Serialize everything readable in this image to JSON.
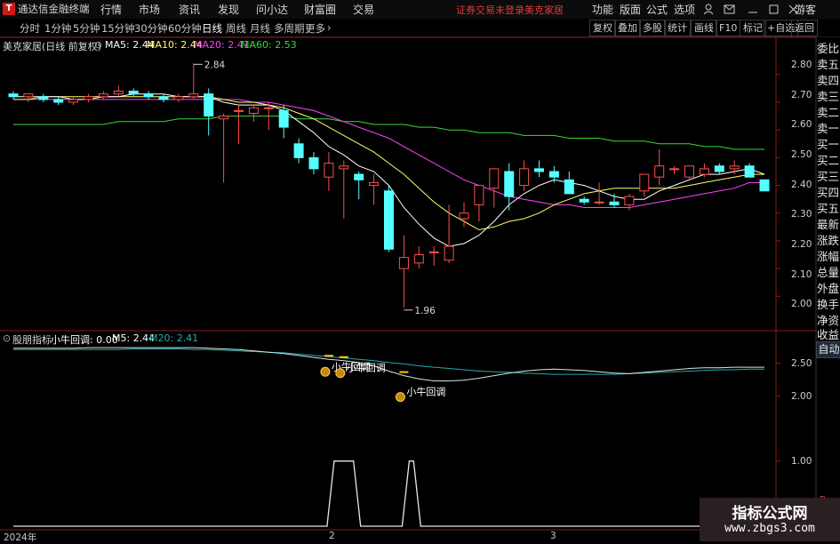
{
  "menubar": {
    "app_title": "通达信金融终端",
    "items": [
      "行情",
      "市场",
      "资讯",
      "发现",
      "问小达",
      "财富圈",
      "交易"
    ],
    "status_login": "证券交易未登录",
    "status_stock": "美克家居",
    "right_items": [
      "功能",
      "版面",
      "公式",
      "选项"
    ],
    "guest": "游客"
  },
  "toolbar": {
    "periods": [
      "分时",
      "1分钟",
      "5分钟",
      "15分钟",
      "30分钟",
      "60分钟",
      "日线",
      "周线",
      "月线",
      "多周期",
      "更多"
    ],
    "active_period": "日线",
    "right_buttons": [
      "复权",
      "叠加",
      "多股",
      "统计",
      "画线",
      "F10",
      "标记",
      "+自选",
      "返回"
    ]
  },
  "main_legend": {
    "title": "美克家居(日线 前复权)",
    "ma5": "MA5: 2.44",
    "ma10": "MA10: 2.44",
    "ma20": "MA20: 2.41",
    "ma60": "MA60: 2.53",
    "high_label": "2.84",
    "low_label": "1.96"
  },
  "sub_legend": {
    "name": "股朋指标",
    "signal": "小牛回调: 0.00",
    "m5": "M5: 2.44",
    "m20": "M20: 2.41",
    "marker_label": "小牛回调"
  },
  "main_axis": [
    "2.80",
    "2.70",
    "2.60",
    "2.50",
    "2.40",
    "2.30",
    "2.20",
    "2.10",
    "2.00"
  ],
  "sub_axis": [
    "2.50",
    "2.00",
    "1.00"
  ],
  "r_label": "R",
  "x_axis": [
    "2024年",
    "2",
    "3"
  ],
  "side_panel": [
    "委比",
    "卖五",
    "卖四",
    "卖三",
    "卖二",
    "卖一",
    "买一",
    "买二",
    "买三",
    "买四",
    "买五",
    "最新",
    "涨跌",
    "涨幅",
    "总量",
    "外盘",
    "换手",
    "净资",
    "收益"
  ],
  "side_auto": "自动",
  "watermark": {
    "title": "指标公式网",
    "url": "www.zbgs3.com"
  },
  "colors": {
    "up": "#ff4d4d",
    "down": "#54ffff",
    "ma5": "#ffffff",
    "ma10": "#ffff66",
    "ma20": "#ff44ff",
    "ma60": "#33dd33",
    "m20": "#22aaaa"
  },
  "chart_data": {
    "type": "candlestick",
    "ylim": [
      1.94,
      2.87
    ],
    "candles": [
      {
        "o": 2.73,
        "h": 2.74,
        "l": 2.71,
        "c": 2.72
      },
      {
        "o": 2.72,
        "h": 2.73,
        "l": 2.7,
        "c": 2.73
      },
      {
        "o": 2.72,
        "h": 2.73,
        "l": 2.7,
        "c": 2.71
      },
      {
        "o": 2.71,
        "h": 2.72,
        "l": 2.69,
        "c": 2.7
      },
      {
        "o": 2.7,
        "h": 2.72,
        "l": 2.69,
        "c": 2.71
      },
      {
        "o": 2.71,
        "h": 2.73,
        "l": 2.7,
        "c": 2.72
      },
      {
        "o": 2.72,
        "h": 2.74,
        "l": 2.71,
        "c": 2.73
      },
      {
        "o": 2.73,
        "h": 2.76,
        "l": 2.72,
        "c": 2.74
      },
      {
        "o": 2.74,
        "h": 2.75,
        "l": 2.72,
        "c": 2.73
      },
      {
        "o": 2.73,
        "h": 2.74,
        "l": 2.71,
        "c": 2.72
      },
      {
        "o": 2.72,
        "h": 2.73,
        "l": 2.7,
        "c": 2.71
      },
      {
        "o": 2.71,
        "h": 2.73,
        "l": 2.7,
        "c": 2.72
      },
      {
        "o": 2.72,
        "h": 2.84,
        "l": 2.71,
        "c": 2.73
      },
      {
        "o": 2.73,
        "h": 2.75,
        "l": 2.58,
        "c": 2.65
      },
      {
        "o": 2.64,
        "h": 2.66,
        "l": 2.41,
        "c": 2.65
      },
      {
        "o": 2.67,
        "h": 2.69,
        "l": 2.55,
        "c": 2.67
      },
      {
        "o": 2.66,
        "h": 2.69,
        "l": 2.63,
        "c": 2.68
      },
      {
        "o": 2.68,
        "h": 2.7,
        "l": 2.6,
        "c": 2.68
      },
      {
        "o": 2.67,
        "h": 2.69,
        "l": 2.57,
        "c": 2.61
      },
      {
        "o": 2.55,
        "h": 2.57,
        "l": 2.48,
        "c": 2.5
      },
      {
        "o": 2.5,
        "h": 2.52,
        "l": 2.44,
        "c": 2.46
      },
      {
        "o": 2.43,
        "h": 2.52,
        "l": 2.38,
        "c": 2.48
      },
      {
        "o": 2.46,
        "h": 2.49,
        "l": 2.28,
        "c": 2.47
      },
      {
        "o": 2.44,
        "h": 2.45,
        "l": 2.35,
        "c": 2.42
      },
      {
        "o": 2.4,
        "h": 2.44,
        "l": 2.33,
        "c": 2.41
      },
      {
        "o": 2.38,
        "h": 2.4,
        "l": 2.16,
        "c": 2.17
      },
      {
        "o": 2.1,
        "h": 2.22,
        "l": 1.96,
        "c": 2.14
      },
      {
        "o": 2.12,
        "h": 2.18,
        "l": 2.1,
        "c": 2.15
      },
      {
        "o": 2.16,
        "h": 2.18,
        "l": 2.11,
        "c": 2.16
      },
      {
        "o": 2.13,
        "h": 2.33,
        "l": 2.12,
        "c": 2.18
      },
      {
        "o": 2.28,
        "h": 2.34,
        "l": 2.25,
        "c": 2.3
      },
      {
        "o": 2.33,
        "h": 2.4,
        "l": 2.27,
        "c": 2.4
      },
      {
        "o": 2.39,
        "h": 2.46,
        "l": 2.32,
        "c": 2.46
      },
      {
        "o": 2.45,
        "h": 2.48,
        "l": 2.31,
        "c": 2.36
      },
      {
        "o": 2.4,
        "h": 2.49,
        "l": 2.38,
        "c": 2.46
      },
      {
        "o": 2.46,
        "h": 2.49,
        "l": 2.43,
        "c": 2.45
      },
      {
        "o": 2.45,
        "h": 2.47,
        "l": 2.41,
        "c": 2.43
      },
      {
        "o": 2.42,
        "h": 2.45,
        "l": 2.37,
        "c": 2.37
      },
      {
        "o": 2.35,
        "h": 2.36,
        "l": 2.33,
        "c": 2.34
      },
      {
        "o": 2.34,
        "h": 2.41,
        "l": 2.33,
        "c": 2.34
      },
      {
        "o": 2.34,
        "h": 2.37,
        "l": 2.32,
        "c": 2.33
      },
      {
        "o": 2.33,
        "h": 2.37,
        "l": 2.31,
        "c": 2.36
      },
      {
        "o": 2.38,
        "h": 2.44,
        "l": 2.36,
        "c": 2.44
      },
      {
        "o": 2.43,
        "h": 2.53,
        "l": 2.4,
        "c": 2.47
      },
      {
        "o": 2.46,
        "h": 2.47,
        "l": 2.44,
        "c": 2.46
      },
      {
        "o": 2.43,
        "h": 2.46,
        "l": 2.42,
        "c": 2.47
      },
      {
        "o": 2.44,
        "h": 2.48,
        "l": 2.43,
        "c": 2.46
      },
      {
        "o": 2.47,
        "h": 2.48,
        "l": 2.44,
        "c": 2.45
      },
      {
        "o": 2.46,
        "h": 2.49,
        "l": 2.44,
        "c": 2.47
      },
      {
        "o": 2.47,
        "h": 2.48,
        "l": 2.43,
        "c": 2.43
      },
      {
        "o": 2.42,
        "h": 2.42,
        "l": 2.38,
        "c": 2.38
      }
    ],
    "ma5": [
      2.72,
      2.72,
      2.72,
      2.72,
      2.71,
      2.71,
      2.72,
      2.72,
      2.73,
      2.73,
      2.73,
      2.72,
      2.72,
      2.72,
      2.7,
      2.69,
      2.69,
      2.69,
      2.67,
      2.63,
      2.59,
      2.54,
      2.51,
      2.47,
      2.45,
      2.4,
      2.32,
      2.26,
      2.21,
      2.18,
      2.19,
      2.22,
      2.27,
      2.33,
      2.37,
      2.4,
      2.42,
      2.41,
      2.4,
      2.38,
      2.36,
      2.35,
      2.35,
      2.38,
      2.4,
      2.42,
      2.44,
      2.44,
      2.45,
      2.46,
      2.44
    ],
    "ma10": [
      2.71,
      2.71,
      2.72,
      2.72,
      2.72,
      2.72,
      2.72,
      2.72,
      2.72,
      2.72,
      2.72,
      2.72,
      2.72,
      2.72,
      2.71,
      2.7,
      2.7,
      2.69,
      2.68,
      2.66,
      2.64,
      2.61,
      2.58,
      2.55,
      2.52,
      2.48,
      2.44,
      2.39,
      2.34,
      2.3,
      2.27,
      2.24,
      2.25,
      2.27,
      2.28,
      2.3,
      2.33,
      2.35,
      2.37,
      2.38,
      2.39,
      2.39,
      2.39,
      2.39,
      2.39,
      2.4,
      2.41,
      2.42,
      2.43,
      2.44,
      2.44
    ],
    "ma20": [
      2.71,
      2.71,
      2.71,
      2.71,
      2.71,
      2.71,
      2.71,
      2.71,
      2.71,
      2.71,
      2.71,
      2.71,
      2.71,
      2.71,
      2.71,
      2.71,
      2.7,
      2.7,
      2.69,
      2.68,
      2.67,
      2.65,
      2.63,
      2.61,
      2.59,
      2.57,
      2.54,
      2.51,
      2.48,
      2.45,
      2.42,
      2.4,
      2.38,
      2.36,
      2.35,
      2.34,
      2.33,
      2.33,
      2.32,
      2.32,
      2.32,
      2.32,
      2.33,
      2.34,
      2.35,
      2.36,
      2.37,
      2.38,
      2.39,
      2.41,
      2.41
    ],
    "ma60": [
      2.62,
      2.62,
      2.62,
      2.62,
      2.62,
      2.62,
      2.62,
      2.63,
      2.63,
      2.63,
      2.63,
      2.64,
      2.64,
      2.64,
      2.65,
      2.65,
      2.65,
      2.65,
      2.65,
      2.64,
      2.64,
      2.64,
      2.63,
      2.63,
      2.62,
      2.62,
      2.62,
      2.61,
      2.61,
      2.6,
      2.6,
      2.59,
      2.59,
      2.59,
      2.58,
      2.58,
      2.58,
      2.57,
      2.57,
      2.57,
      2.56,
      2.56,
      2.56,
      2.55,
      2.55,
      2.55,
      2.54,
      2.54,
      2.53,
      2.53,
      2.53
    ],
    "sub": {
      "ylim": [
        0.0,
        2.85
      ],
      "m5": [
        2.73,
        2.73,
        2.73,
        2.73,
        2.73,
        2.74,
        2.74,
        2.74,
        2.74,
        2.74,
        2.74,
        2.74,
        2.74,
        2.73,
        2.72,
        2.71,
        2.69,
        2.67,
        2.65,
        2.62,
        2.59,
        2.56,
        2.54,
        2.51,
        2.46,
        2.38,
        2.31,
        2.26,
        2.23,
        2.23,
        2.24,
        2.27,
        2.31,
        2.35,
        2.38,
        2.4,
        2.41,
        2.4,
        2.39,
        2.37,
        2.35,
        2.34,
        2.36,
        2.38,
        2.4,
        2.42,
        2.43,
        2.43,
        2.44,
        2.44,
        2.44
      ],
      "m20": [
        2.71,
        2.71,
        2.71,
        2.71,
        2.71,
        2.71,
        2.71,
        2.71,
        2.72,
        2.72,
        2.72,
        2.72,
        2.71,
        2.71,
        2.7,
        2.69,
        2.68,
        2.67,
        2.66,
        2.64,
        2.62,
        2.6,
        2.58,
        2.56,
        2.54,
        2.51,
        2.49,
        2.46,
        2.44,
        2.42,
        2.4,
        2.38,
        2.37,
        2.36,
        2.35,
        2.34,
        2.33,
        2.33,
        2.33,
        2.33,
        2.33,
        2.34,
        2.35,
        2.36,
        2.37,
        2.38,
        2.39,
        2.4,
        2.4,
        2.41,
        2.41
      ],
      "signal_pulses": [
        {
          "start": 21,
          "end": 23
        },
        {
          "start": 26,
          "end": 27
        }
      ],
      "markers": [
        21,
        22,
        26
      ]
    }
  }
}
